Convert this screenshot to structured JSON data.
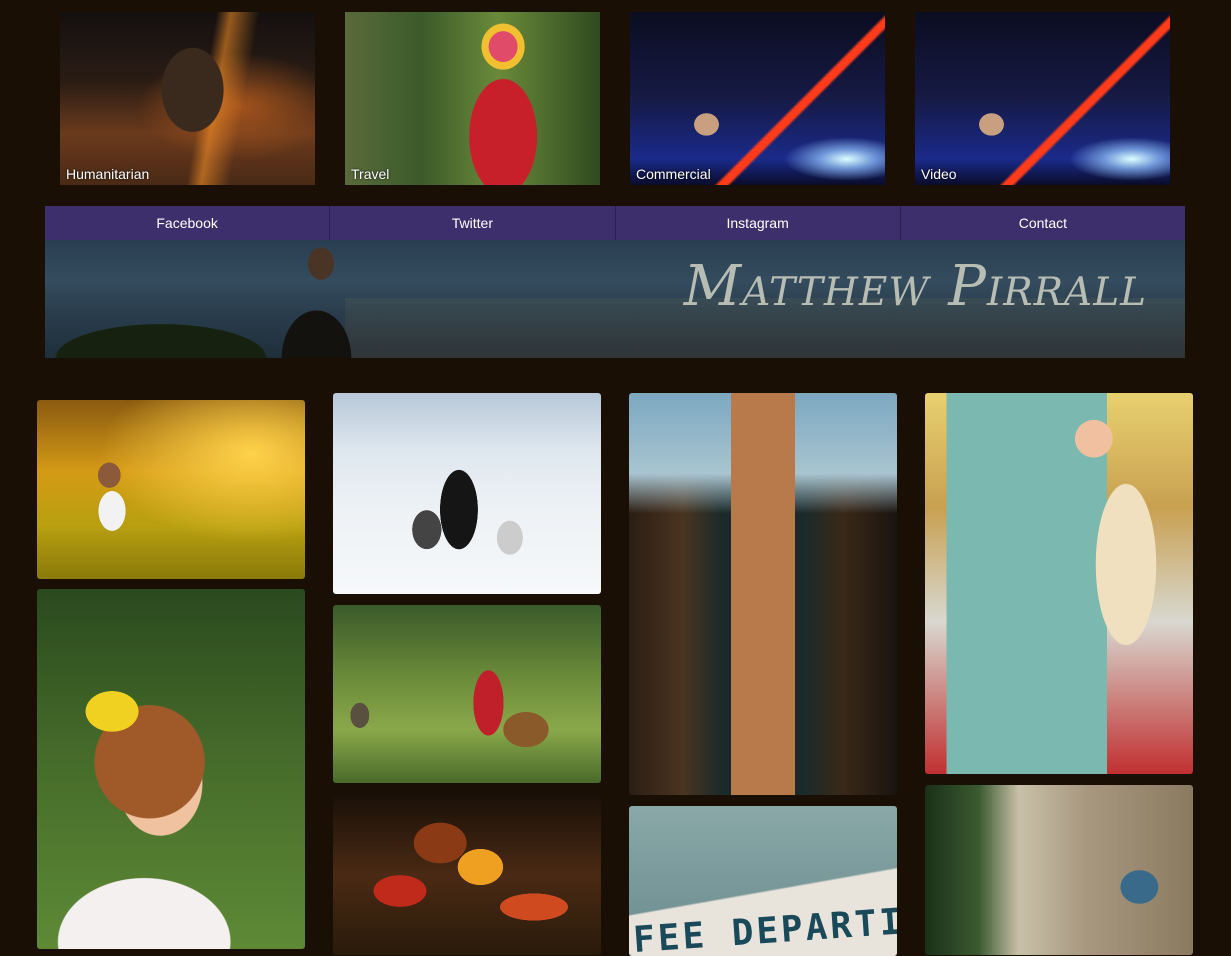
{
  "categories": [
    {
      "label": "Humanitarian",
      "art": "art-human"
    },
    {
      "label": "Travel",
      "art": "art-travel"
    },
    {
      "label": "Commercial",
      "art": "art-stage"
    },
    {
      "label": "Video",
      "art": "art-stage"
    }
  ],
  "nav": {
    "facebook": "Facebook",
    "twitter": "Twitter",
    "instagram": "Instagram",
    "contact": "Contact"
  },
  "banner": {
    "title": "Matthew Pirrall"
  },
  "gallery_sign_text": "FEE DEPARTI",
  "colors": {
    "background": "#1a0f05",
    "nav": "#3d2f6c",
    "banner_text": "#b8bdb4"
  }
}
